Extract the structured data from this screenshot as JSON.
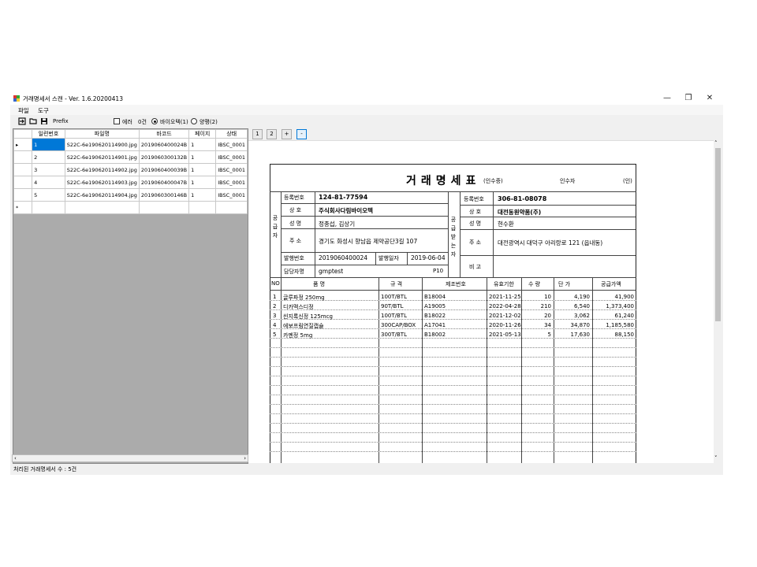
{
  "window": {
    "title": "거래명세서 스캔 - Ver. 1.6.20200413",
    "minimize": "—",
    "restore": "❐",
    "close": "✕"
  },
  "menu": {
    "file": "파일",
    "tools": "도구"
  },
  "toolbar": {
    "prefix_label": "Prefix",
    "error_label": "에러",
    "count_label": "0건",
    "radio1": "바이오텍(1)",
    "radio2": "양평(2)"
  },
  "grid": {
    "columns": [
      "일련번호",
      "파일명",
      "바코드",
      "페이지",
      "상태"
    ],
    "rows": [
      [
        "1",
        "S22C-6e190620114900.jpg",
        "2019060400024B",
        "1",
        "IBSC_0001"
      ],
      [
        "2",
        "S22C-6e190620114901.jpg",
        "2019060300132B",
        "1",
        "IBSC_0001"
      ],
      [
        "3",
        "S22C-6e190620114902.jpg",
        "2019060400039B",
        "1",
        "IBSC_0001"
      ],
      [
        "4",
        "S22C-6e190620114903.jpg",
        "2019060400047B",
        "1",
        "IBSC_0001"
      ],
      [
        "5",
        "S22C-6e190620114904.jpg",
        "2019060300146B",
        "1",
        "IBSC_0001"
      ]
    ],
    "current_marker": "▸",
    "new_marker": "*"
  },
  "pager": [
    "1",
    "2",
    "+",
    "-"
  ],
  "status": "처리된 거래명세서 수 : 5건",
  "doc": {
    "title": "거래명세표",
    "subtitle": "(인수증)",
    "receiver": "인수자",
    "seal": "(인)",
    "supplier": {
      "side": "공급자",
      "reg_label": "등록번호",
      "reg": "124-81-77594",
      "name_label": "상 호",
      "name": "주식회사다림바이오텍",
      "rep_label": "성 명",
      "rep": "정종섭, 김상기",
      "addr_label": "주 소",
      "addr": "경기도 화성시 향남읍 제약공단3길 107",
      "issue_label": "발행번호",
      "issue": "2019060400024",
      "date_label": "발행일자",
      "date": "2019-06-04",
      "contact_label": "담당자명",
      "contact": "gmptest",
      "code": "P10"
    },
    "buyer": {
      "side": "공급받는자",
      "reg_label": "등록번호",
      "reg": "306-81-08078",
      "name_label": "상 호",
      "name": "대전동원약품(주)",
      "rep_label": "성 명",
      "rep": "현수환",
      "addr_label": "주 소",
      "addr": "대전광역시 대덕구 아리랑로 121 (읍내동)",
      "note_label": "비 고"
    },
    "item_columns": [
      "NO",
      "품 명",
      "규 격",
      "제조번호",
      "유효기한",
      "수 량",
      "단 가",
      "공급가액"
    ],
    "items": [
      [
        "1",
        "글루파정 250mg",
        "100T/BTL",
        "B18004",
        "2021-11-25",
        "10",
        "4,190",
        "41,900"
      ],
      [
        "2",
        "디카맥스디정",
        "90T/BTL",
        "A19005",
        "2022-04-28",
        "210",
        "6,540",
        "1,373,400"
      ],
      [
        "3",
        "씬지록신정 125mcg",
        "100T/BTL",
        "B18022",
        "2021-12-02",
        "20",
        "3,062",
        "61,240"
      ],
      [
        "4",
        "에보프림연질캡슐",
        "300CAP/BOX",
        "A17041",
        "2020-11-26",
        "34",
        "34,870",
        "1,185,580"
      ],
      [
        "5",
        "카멘정 5mg",
        "300T/BTL",
        "B18002",
        "2021-05-13",
        "5",
        "17,630",
        "88,150"
      ]
    ]
  },
  "colors": {
    "selection": "#0078d7",
    "grid_bg": "#ababab",
    "chrome": "#f0f0f0"
  }
}
